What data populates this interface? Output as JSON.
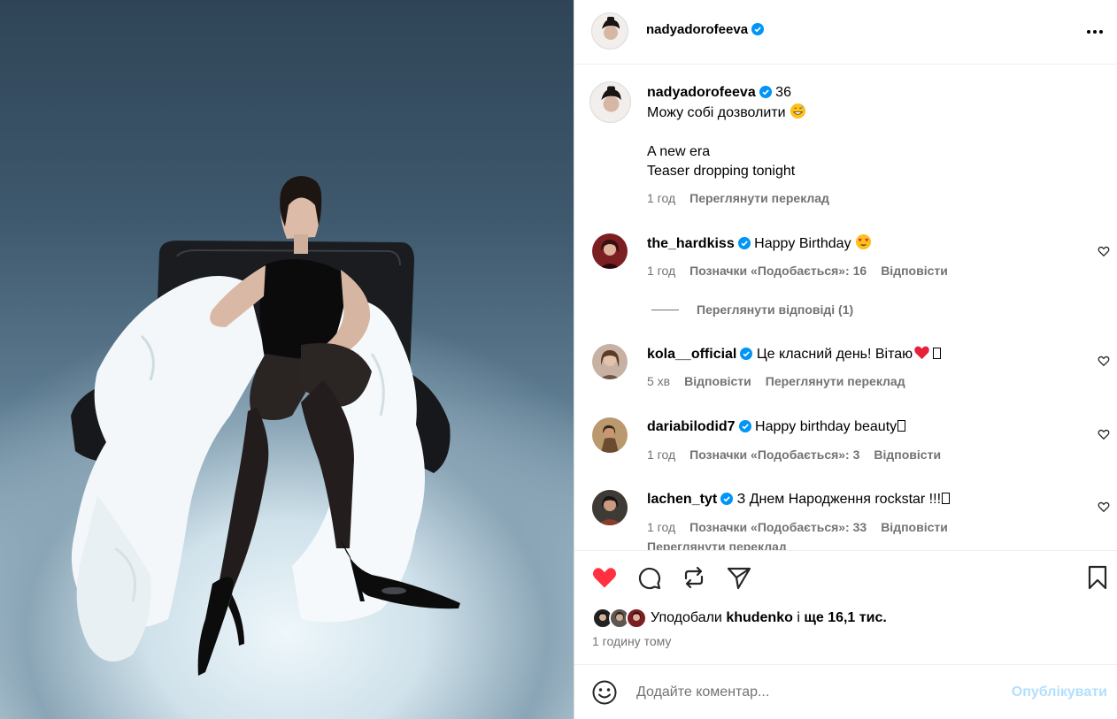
{
  "post": {
    "author": "nadyadorofeeva",
    "author_count": "36",
    "caption_lines": [
      "Можу собі дозволити",
      "A new era",
      "Teaser dropping tonight"
    ],
    "caption_time": "1 год",
    "caption_translate": "Переглянути переклад"
  },
  "comments": [
    {
      "user": "the_hardkiss",
      "text": "Happy Birthday",
      "emoji": "heart-eyes",
      "time": "1 год",
      "likes": "Позначки «Подобається»: 16",
      "reply": "Відповісти"
    },
    {
      "user": "kola__official",
      "text": "Це класний день! Вітаю",
      "emoji": "red-heart",
      "time": "5 хв",
      "reply": "Відповісти",
      "translate": "Переглянути переклад"
    },
    {
      "user": "dariabilodid7",
      "text": "Happy birthday beauty",
      "time": "1 год",
      "likes": "Позначки «Подобається»: 3",
      "reply": "Відповісти"
    },
    {
      "user": "lachen_tyt",
      "text": "З Днем Народження rockstar !!!",
      "time": "1 год",
      "likes": "Позначки «Подобається»: 33",
      "reply": "Відповісти",
      "translate": "Переглянути переклад"
    }
  ],
  "view_replies": "Переглянути відповіді (1)",
  "likes": {
    "prefix": "Уподобали",
    "user": "khudenko",
    "middle": "і",
    "rest": "ще 16,1 тис."
  },
  "post_time": "1 годину тому",
  "compose": {
    "placeholder": "Додайте коментар...",
    "submit": "Опублікувати"
  },
  "colors": {
    "like_red": "#ff3040",
    "verified_blue": "#0095f6",
    "muted": "#737373",
    "submit_disabled": "#b2dffc"
  }
}
